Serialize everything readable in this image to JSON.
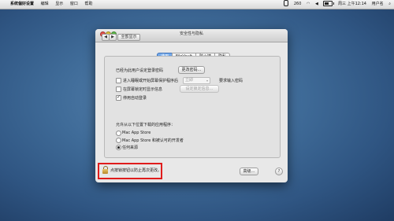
{
  "menubar": {
    "apple": "",
    "app_name": "系统偏好设置",
    "items": [
      "编辑",
      "显示",
      "窗口",
      "帮助"
    ],
    "battery_count": "260",
    "clock": "周三 上午12:14",
    "user": "用户名"
  },
  "window": {
    "title": "安全性与隐私",
    "back": "◀",
    "forward": "▶",
    "show_all": "全部显示"
  },
  "tabs": [
    "通用",
    "FileVault",
    "防火墙",
    "隐私"
  ],
  "general": {
    "password_set_label": "已经为此用户设定登录密码",
    "change_password_button": "更改密码…",
    "require_password": {
      "label": "进入睡眠或开始屏幕保护程序后",
      "delay": "立即",
      "suffix": "要求输入密码",
      "checked": false
    },
    "show_message": {
      "label": "在屏幕锁定时显示信息",
      "button": "设定锁定信息…",
      "checked": false
    },
    "disable_autologin": {
      "label": "停用自动登录",
      "checked": true
    },
    "allow_apps_label": "允许从以下位置下载的应用程序：",
    "sources": [
      {
        "label": "Mac App Store",
        "selected": false
      },
      {
        "label": "Mac App Store 和被认可的开发者",
        "selected": false
      },
      {
        "label": "任何来源",
        "selected": true
      }
    ]
  },
  "footer": {
    "lock_text": "点按锁按钮以防止再次更改。",
    "advanced_button": "高级…",
    "help": "?"
  },
  "colors": {
    "highlight_border": "#e01c1c",
    "active_tab": "#3d82db"
  }
}
